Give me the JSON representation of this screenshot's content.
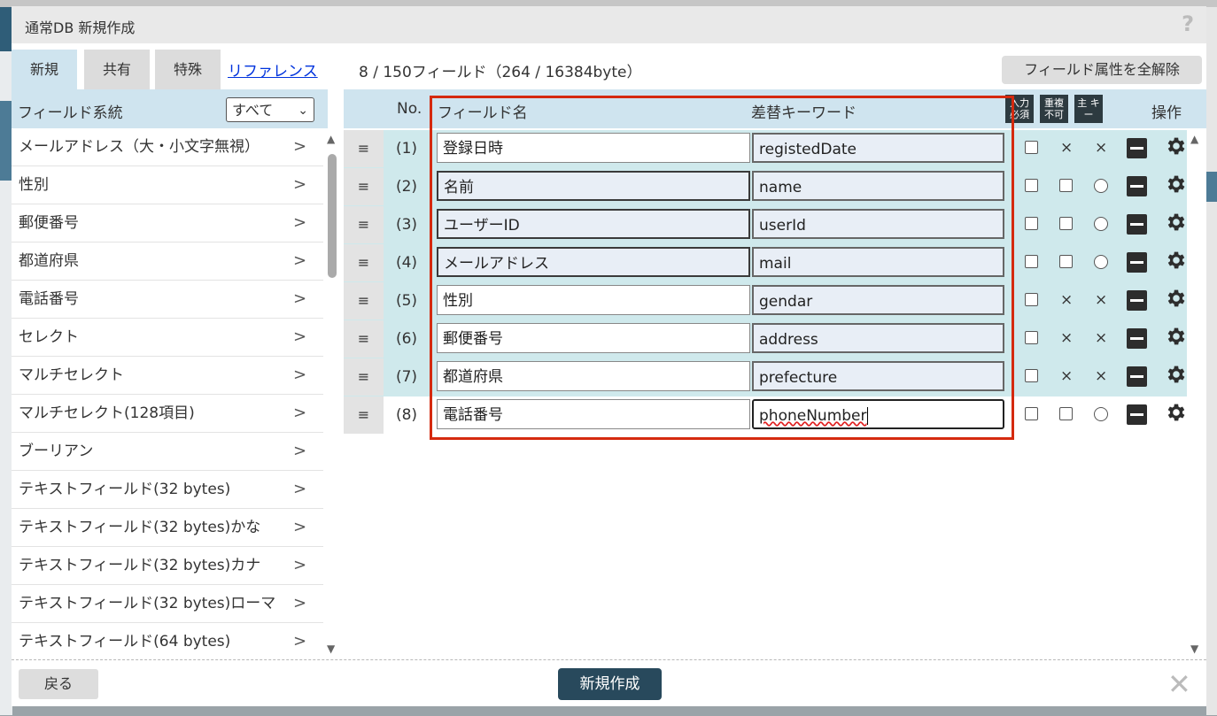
{
  "dialog": {
    "title": "通常DB 新規作成",
    "help_icon": "?"
  },
  "tabs": [
    {
      "label": "新規",
      "active": true
    },
    {
      "label": "共有",
      "active": false
    },
    {
      "label": "特殊",
      "active": false
    }
  ],
  "reference_link": "リファレンス",
  "field_count": "8 / 150フィールド（264 / 16384byte）",
  "clear_button": "フィールド属性を全解除",
  "left_panel": {
    "header": "フィールド系統",
    "filter_value": "すべて",
    "arrow": ">",
    "items": [
      "メールアドレス（大・小文字無視）",
      "性別",
      "郵便番号",
      "都道府県",
      "電話番号",
      "セレクト",
      "マルチセレクト",
      "マルチセレクト(128項目)",
      "ブーリアン",
      "テキストフィールド(32 bytes)",
      "テキストフィールド(32 bytes)かな",
      "テキストフィールド(32 bytes)カナ",
      "テキストフィールド(32 bytes)ローマ",
      "テキストフィールド(64 bytes)"
    ]
  },
  "grid": {
    "headers": {
      "no": "No.",
      "field_name": "フィールド名",
      "keyword": "差替キーワード",
      "required": "入力 必須",
      "unique": "重複 不可",
      "primary": "主 キー",
      "actions": "操作"
    },
    "handle_glyph": "≡",
    "cross_glyph": "×",
    "rows": [
      {
        "no": "(1)",
        "name": "登録日時",
        "key": "registedDate",
        "unique": "x",
        "primary": "x",
        "highlighted": true
      },
      {
        "no": "(2)",
        "name": "名前",
        "key": "name",
        "unique": "box",
        "primary": "radio",
        "highlighted": true
      },
      {
        "no": "(3)",
        "name": "ユーザーID",
        "key": "userId",
        "unique": "box",
        "primary": "radio",
        "highlighted": true
      },
      {
        "no": "(4)",
        "name": "メールアドレス",
        "key": "mail",
        "unique": "box",
        "primary": "radio",
        "highlighted": true
      },
      {
        "no": "(5)",
        "name": "性別",
        "key": "gendar",
        "unique": "x",
        "primary": "x",
        "highlighted": true
      },
      {
        "no": "(6)",
        "name": "郵便番号",
        "key": "address",
        "unique": "x",
        "primary": "x",
        "highlighted": true
      },
      {
        "no": "(7)",
        "name": "都道府県",
        "key": "prefecture",
        "unique": "x",
        "primary": "x",
        "highlighted": true
      },
      {
        "no": "(8)",
        "name": "電話番号",
        "key": "phoneNumber",
        "unique": "box",
        "primary": "radio",
        "highlighted": false
      }
    ]
  },
  "footer": {
    "back": "戻る",
    "create": "新規作成",
    "close": "✕"
  },
  "colors": {
    "accent": "#28495c",
    "header_bg": "#cfe4ef",
    "row_highlight": "#cfe9ec",
    "highlight_border": "#d52a0f"
  }
}
